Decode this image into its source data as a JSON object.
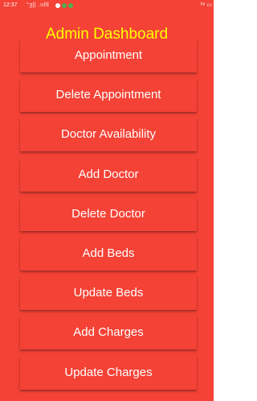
{
  "status_bar": {
    "time": "12:37",
    "network": "°ʒ|| .ıılll",
    "right": "ʰ⁸ ▭"
  },
  "app": {
    "title": "Admin Dashboard",
    "title_color": "#ffff00",
    "background": "#f44236"
  },
  "menu": {
    "appointment": "Appointment",
    "delete_appointment": "Delete Appointment",
    "doctor_availability": "Doctor Availability",
    "add_doctor": "Add Doctor",
    "delete_doctor": "Delete Doctor",
    "add_beds": "Add Beds",
    "update_beds": "Update Beds",
    "add_charges": "Add Charges",
    "update_charges": "Update Charges"
  }
}
